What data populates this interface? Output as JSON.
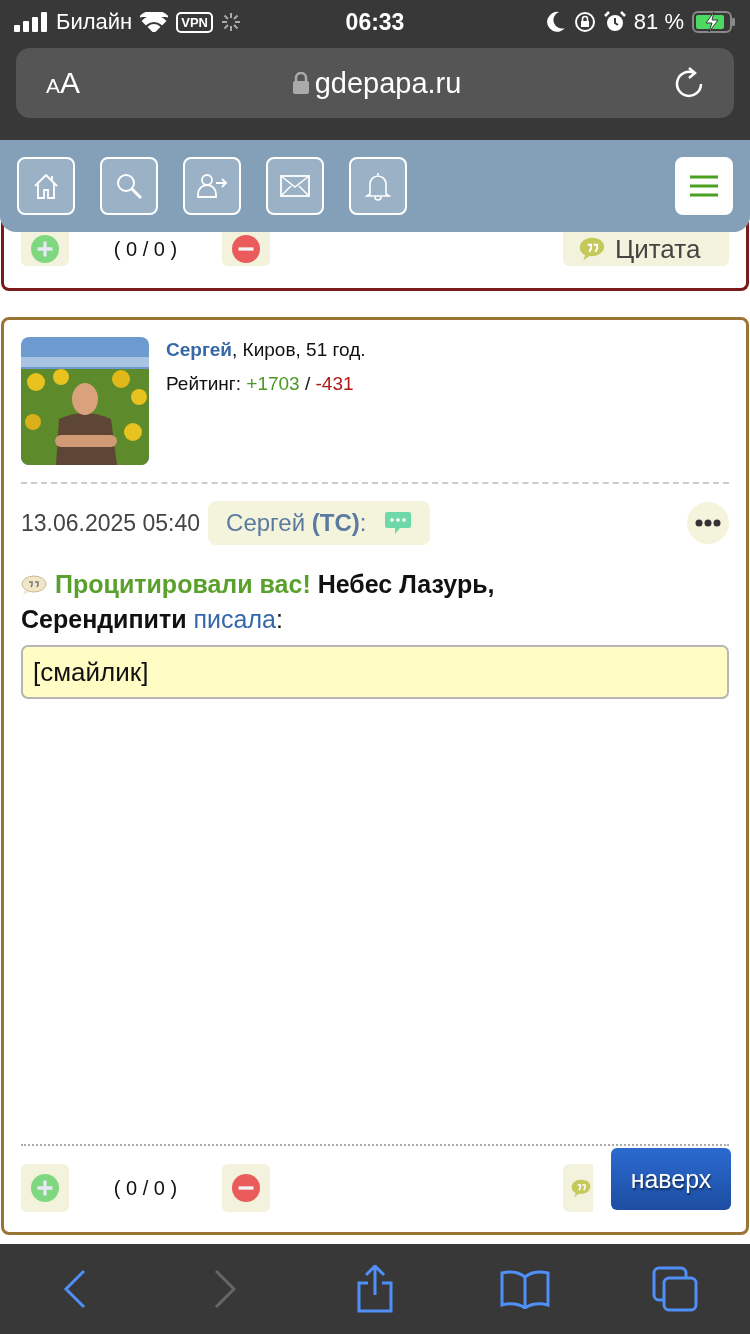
{
  "status_bar": {
    "carrier": "Билайн",
    "vpn": "VPN",
    "time": "06:33",
    "battery": "81 %"
  },
  "browser": {
    "font_button": "AA",
    "url": "gdepapa.ru"
  },
  "posts": [
    {
      "footer": {
        "votes": "( 0 / 0 )",
        "quote_label": "Цитата"
      }
    },
    {
      "author": {
        "name": "Сергей",
        "details": ", Киров, 51 год.",
        "rating_label": "Рейтинг:",
        "rating_plus": "+1703",
        "rating_sep": " / ",
        "rating_minus": "-431"
      },
      "date": "13.06.2025 05:40",
      "addressee": "Сергей **(ТС)**:",
      "quote_notice": "Процитировали вас!",
      "quote_author": " Небес Лазурь, Серендипити ",
      "quote_link": "писала",
      "quote_colon": ":",
      "quote_text": "[смайлик]",
      "footer": {
        "votes": "( 0 / 0 )"
      }
    }
  ],
  "scroll_top_button": "наверх",
  "toolbar": {
    "back": {
      "disabled": false
    },
    "forward": {
      "disabled": true
    }
  }
}
